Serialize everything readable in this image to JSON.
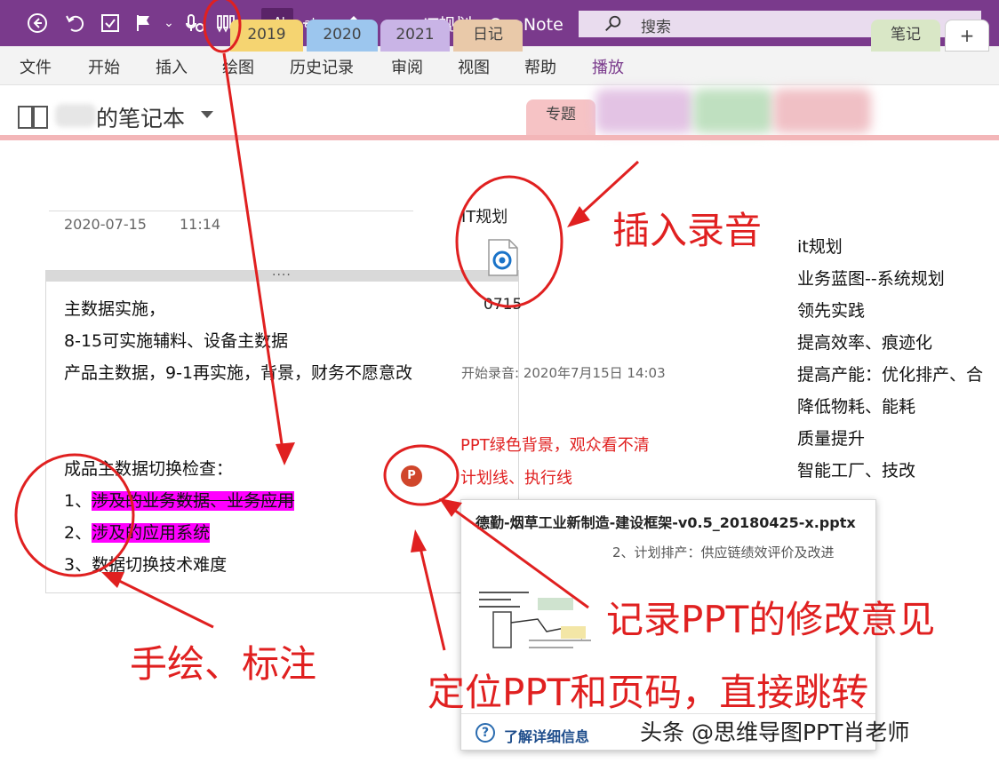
{
  "window": {
    "title": "IT规划  -  OneNote",
    "search_placeholder": "搜索"
  },
  "quick_access": [
    {
      "name": "back-icon",
      "glyph": "⊖"
    },
    {
      "name": "undo-icon",
      "glyph": "↶"
    },
    {
      "name": "checkbox-icon",
      "glyph": "☑"
    },
    {
      "name": "flag-icon",
      "glyph": "⚑"
    },
    {
      "name": "dropdown-caret",
      "glyph": "⌄"
    },
    {
      "name": "audio-record-icon",
      "glyph": "🎙"
    },
    {
      "name": "pen-set-icon",
      "glyph": "✎"
    },
    {
      "name": "ink-to-text-icon",
      "glyph": "AI"
    },
    {
      "name": "strikethrough-icon",
      "glyph": "ab"
    },
    {
      "name": "format-painter-icon",
      "glyph": "🖌"
    },
    {
      "name": "customize-toolbar-icon",
      "glyph": "⌄"
    }
  ],
  "menu": [
    "文件",
    "开始",
    "插入",
    "绘图",
    "历史记录",
    "审阅",
    "视图",
    "帮助",
    "播放"
  ],
  "menu_active": "播放",
  "notebook": {
    "title": "的笔记本"
  },
  "sections": [
    {
      "label": "2019",
      "color": "#f5d471"
    },
    {
      "label": "2020",
      "color": "#9cc6ee"
    },
    {
      "label": "2021",
      "color": "#c9b4e6"
    },
    {
      "label": "日记",
      "color": "#e9c9a9"
    },
    {
      "label": "专题",
      "color": "#f6c3c5"
    },
    {
      "label": "笔记",
      "color": "#d9e7c6"
    },
    {
      "label": "+",
      "color": "#ffffff"
    }
  ],
  "page": {
    "date": "2020-07-15",
    "time": "11:14",
    "note_lines": [
      "主数据实施，",
      "8-15可实施辅料、设备主数据",
      "产品主数据，9-1再实施，背景，财务不愿意改",
      "成品主数据切换检查：",
      "1、",
      "涉及的业务数据、业务应用",
      "2、",
      "涉及的应用系统",
      "3、数据切换技术难度"
    ],
    "audio": {
      "title": "IT规划",
      "filename": "0715",
      "start": "开始录音: 2020年7月15日 14:03"
    },
    "right_list": [
      "it规划",
      "业务蓝图--系统规划",
      "领先实践",
      "提高效率、痕迹化",
      "提高产能：优化排产、合",
      "降低物耗、能耗",
      "质量提升",
      "智能工厂、技改"
    ],
    "ppt_comments": [
      "PPT绿色背景，观众看不清",
      "计划线、执行线"
    ],
    "ppt_popup": {
      "filename": "德勤-烟草工业新制造-建设框架-v0.5_20180425-x.pptx",
      "slide": "2、计划排产：供应链绩效评价及改进",
      "help": "了解详细信息"
    }
  },
  "annotations": {
    "insert_audio": "插入录音",
    "record_ppt": "记录PPT的修改意见",
    "hand_draw": "手绘、标注",
    "locate_ppt": "定位PPT和页码，直接跳转",
    "watermark": "头条 @思维导图PPT肖老师"
  },
  "colors": {
    "titlebar": "#7a3a8c",
    "highlight": "#ff00ff",
    "annotation": "#e02020"
  }
}
